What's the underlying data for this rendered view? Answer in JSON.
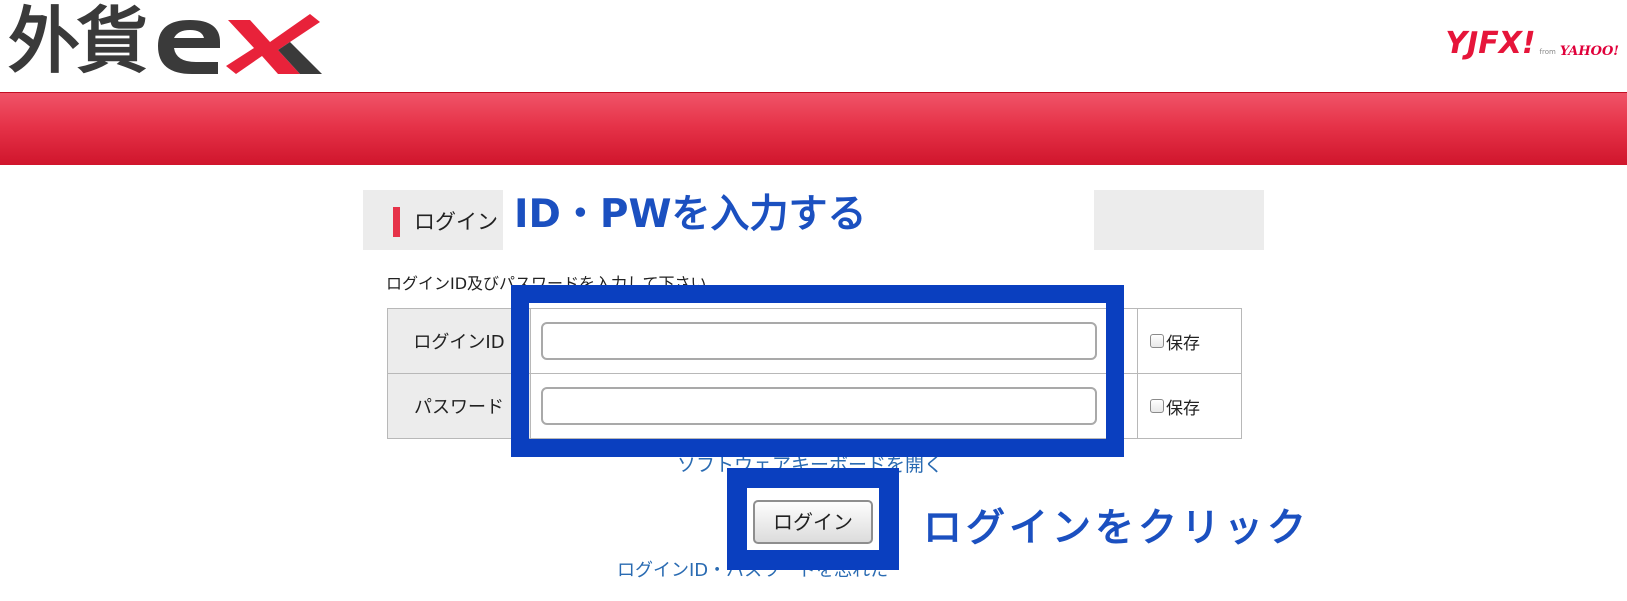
{
  "header": {
    "logo_text_jp": "外貨",
    "logo_text_ex": "ex",
    "brand": "YJFX!",
    "brand_from": "from",
    "brand_yahoo": "YAHOO!"
  },
  "colors": {
    "accent_red": "#e63349",
    "annotation_blue": "#0a3fbf",
    "link_blue": "#2a6bb2"
  },
  "login": {
    "title": "ログイン",
    "instructions": "ログインID及びパスワードを入力して下さい",
    "fields": [
      {
        "label": "ログインID",
        "value": "",
        "save_label": "保存"
      },
      {
        "label": "パスワード",
        "value": "",
        "save_label": "保存"
      }
    ],
    "softkeyboard_link": "ソフトウェアキーボードを開く",
    "button_label": "ログイン",
    "forgot_link": "ログインID・パスワードを忘れた"
  },
  "annotations": {
    "input_note": "ID・PWを入力する",
    "button_note": "ログインをクリック"
  }
}
